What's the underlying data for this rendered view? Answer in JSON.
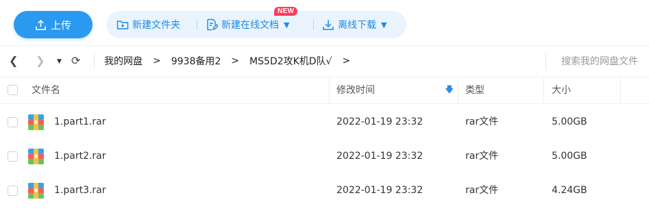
{
  "toolbar": {
    "upload_label": "上传",
    "new_folder_label": "新建文件夹",
    "new_online_doc_label": "新建在线文档",
    "new_badge": "NEW",
    "offline_download_label": "离线下载",
    "accent_color": "#2a9af0"
  },
  "nav": {
    "breadcrumbs": [
      "我的网盘",
      "9938备用2",
      "MS5D2攻K机D队√"
    ],
    "search_placeholder": "搜索我的网盘文件"
  },
  "table": {
    "columns": {
      "name": "文件名",
      "modified": "修改时间",
      "type": "类型",
      "size": "大小"
    },
    "sort": {
      "column": "modified",
      "direction": "descending",
      "icon": "arrow-down-icon"
    },
    "rows": [
      {
        "name": "1.part1.rar",
        "modified": "2022-01-19 23:32",
        "type": "rar文件",
        "size": "5.00GB",
        "icon": "rar-archive-icon"
      },
      {
        "name": "1.part2.rar",
        "modified": "2022-01-19 23:32",
        "type": "rar文件",
        "size": "5.00GB",
        "icon": "rar-archive-icon"
      },
      {
        "name": "1.part3.rar",
        "modified": "2022-01-19 23:32",
        "type": "rar文件",
        "size": "4.24GB",
        "icon": "rar-archive-icon"
      }
    ]
  }
}
